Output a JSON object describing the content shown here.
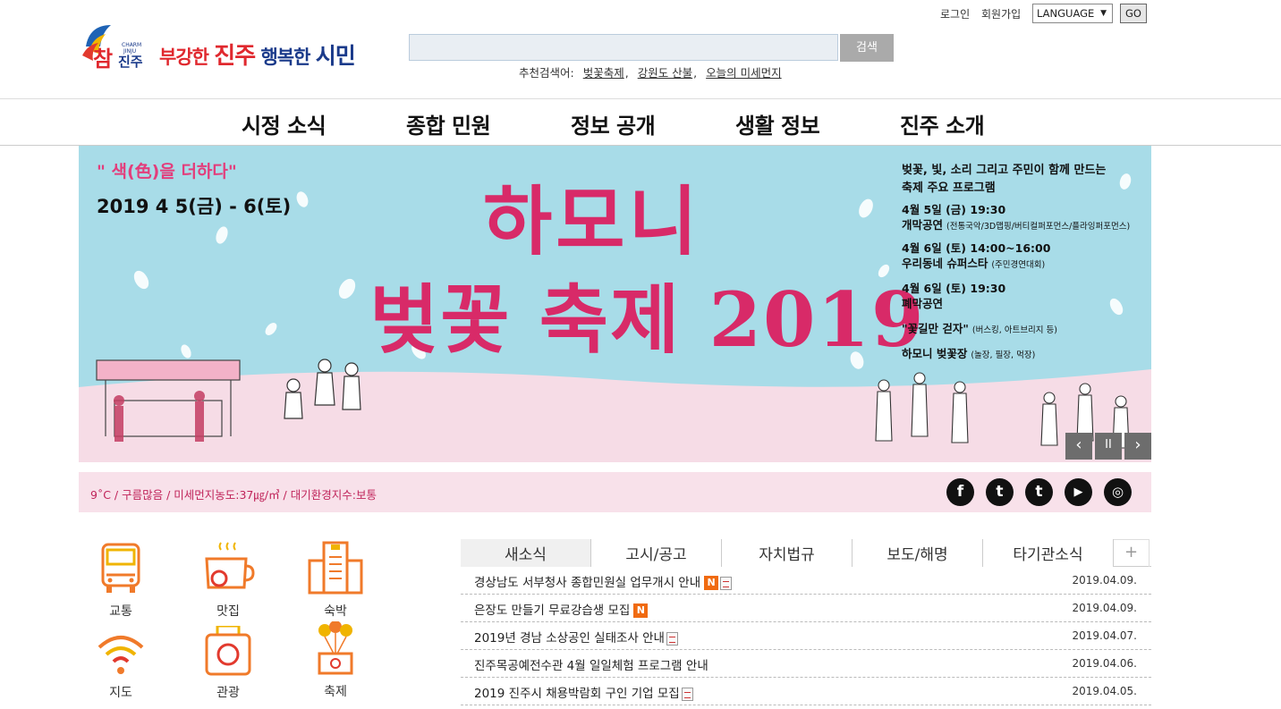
{
  "header": {
    "logo_text": "참진주",
    "logo_small": "CHARM JINJU",
    "slogan_part1": "부강한",
    "slogan_part2": "진주",
    "slogan_part3": "행복한",
    "slogan_part4": "시민",
    "search": {
      "button_label": "검색",
      "value": ""
    },
    "recommend_label": "추천검색어:",
    "recommend_keywords": [
      "벚꽃축제",
      "강원도 산불",
      "오늘의 미세먼지"
    ],
    "login_label": "로그인",
    "join_label": "회원가입",
    "language_label": "LANGUAGE",
    "go_label": "GO"
  },
  "nav": [
    "시정 소식",
    "종합 민원",
    "정보 공개",
    "생활 정보",
    "진주 소개"
  ],
  "banner": {
    "quote": "\" 색(色)을 더하다\"",
    "date": "2019 4  5(금) - 6(토)",
    "title_line1": "하모니",
    "title_line2": "벚꽃 축제 2019",
    "program_head_1": "벚꽃, 빛, 소리 그리고 주민이 함께 만드는",
    "program_head_2": "축제 주요 프로그램",
    "programs": [
      {
        "time": "4월 5일 (금) 19:30",
        "name": "개막공연",
        "note": "(전통국악/3D맵핑/버티컬퍼포먼스/플라잉퍼포먼스)"
      },
      {
        "time": "4월 6일 (토) 14:00~16:00",
        "name": "우리동네 슈퍼스타",
        "note": "(주민경연대회)"
      },
      {
        "time": "4월 6일 (토) 19:30",
        "name": "폐막공연",
        "note": ""
      },
      {
        "time": "",
        "name": "\"꽃길만 걷자\"",
        "note": "(버스킹, 아트브리지 등)"
      },
      {
        "time": "",
        "name": "하모니 벚꽃장",
        "note": "(놀장, 필장, 먹장)"
      }
    ],
    "prev_label": "‹",
    "pause_label": "II",
    "next_label": "›"
  },
  "infobar": {
    "text": "9˚C  /  구름많음  /  미세먼지농도:37㎍/㎥  /  대기환경지수:보통",
    "sns": [
      "f",
      "t",
      "t",
      "▶",
      "◎"
    ]
  },
  "quick_links": [
    "교통",
    "맛집",
    "숙박",
    "지도",
    "관광",
    "축제"
  ],
  "news": {
    "tabs": [
      "새소식",
      "고시/공고",
      "자치법규",
      "보도/해명",
      "타기관소식"
    ],
    "more_label": "+",
    "badge_new": "N",
    "items": [
      {
        "title": "경상남도 서부청사 종합민원실 업무개시 안내",
        "date": "2019.04.09."
      },
      {
        "title": "은장도 만들기 무료강습생 모집",
        "date": "2019.04.09."
      },
      {
        "title": "2019년 경남 소상공인 실태조사 안내",
        "date": "2019.04.07."
      },
      {
        "title": "진주목공예전수관 4월 일일체험 프로그램 안내",
        "date": "2019.04.06."
      },
      {
        "title": "2019 진주시 채용박람회 구인 기업 모집",
        "date": "2019.04.05."
      }
    ]
  },
  "colors": {
    "accent": "#d82a68",
    "banner_sky": "#a8dce8",
    "nav_border": "#cccccc",
    "info_bg": "#f8e1ea"
  }
}
